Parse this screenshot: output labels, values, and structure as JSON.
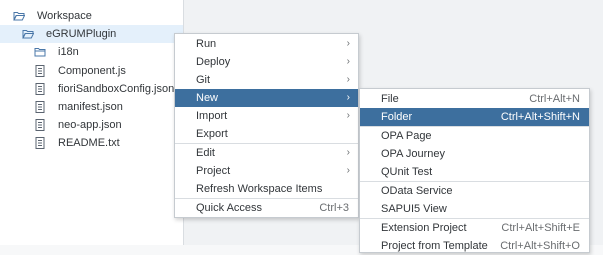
{
  "tree": {
    "root": {
      "label": "Workspace",
      "icon": "folder-open-icon"
    },
    "project": {
      "label": "eGRUMPlugin",
      "icon": "folder-open-icon"
    },
    "items": [
      {
        "label": "i18n",
        "icon": "folder-icon"
      },
      {
        "label": "Component.js",
        "icon": "file-icon"
      },
      {
        "label": "fioriSandboxConfig.json",
        "icon": "file-icon"
      },
      {
        "label": "manifest.json",
        "icon": "file-icon"
      },
      {
        "label": "neo-app.json",
        "icon": "file-icon"
      },
      {
        "label": "README.txt",
        "icon": "file-icon"
      }
    ]
  },
  "context_menu": {
    "items": [
      {
        "label": "Run",
        "has_submenu": true
      },
      {
        "label": "Deploy",
        "has_submenu": true
      },
      {
        "label": "Git",
        "has_submenu": true
      },
      {
        "label": "New",
        "has_submenu": true,
        "active": true
      },
      {
        "label": "Import",
        "has_submenu": true
      },
      {
        "label": "Export"
      },
      {
        "label": "Edit",
        "has_submenu": true
      },
      {
        "label": "Project",
        "has_submenu": true
      },
      {
        "label": "Refresh Workspace Items"
      },
      {
        "label": "Quick Access",
        "shortcut": "Ctrl+3"
      }
    ]
  },
  "new_submenu": {
    "items": [
      {
        "label": "File",
        "shortcut": "Ctrl+Alt+N"
      },
      {
        "label": "Folder",
        "shortcut": "Ctrl+Alt+Shift+N",
        "active": true
      },
      {
        "label": "OPA Page"
      },
      {
        "label": "OPA Journey"
      },
      {
        "label": "QUnit Test"
      },
      {
        "label": "OData Service"
      },
      {
        "label": "SAPUI5 View"
      },
      {
        "label": "Extension Project",
        "shortcut": "Ctrl+Alt+Shift+E"
      },
      {
        "label": "Project from Template",
        "shortcut": "Ctrl+Alt+Shift+O"
      }
    ]
  },
  "colors": {
    "accent": "#3d6f9e",
    "folder_icon": "#4a77a8",
    "file_icon": "#5b6470"
  }
}
